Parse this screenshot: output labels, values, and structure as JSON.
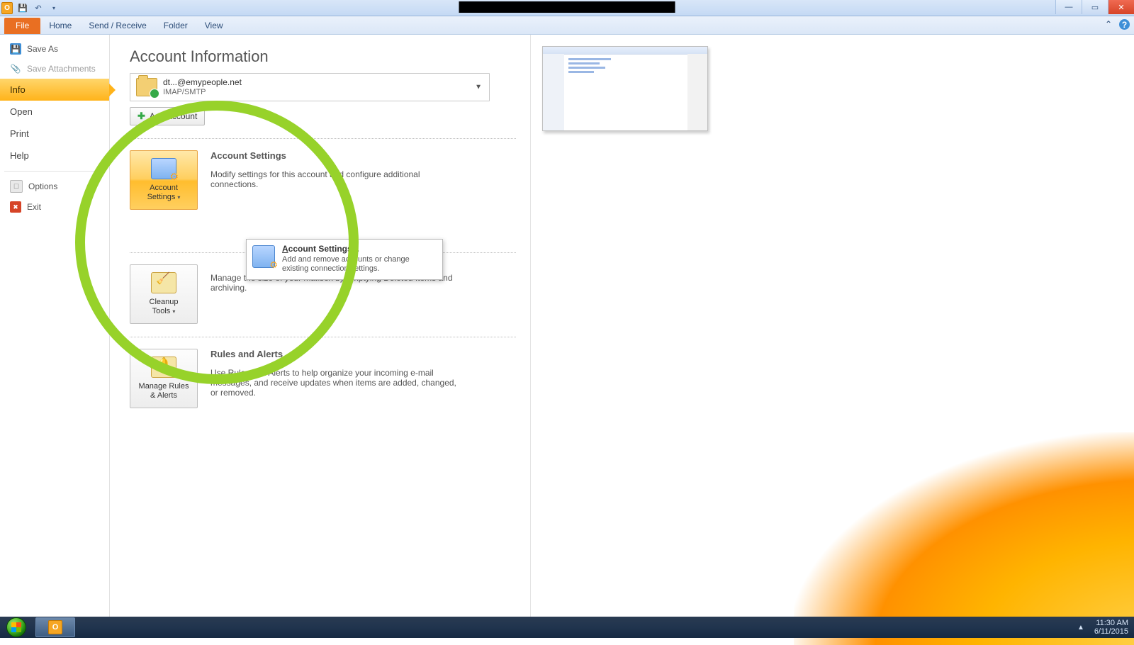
{
  "ribbon": {
    "tabs": [
      "File",
      "Home",
      "Send / Receive",
      "Folder",
      "View"
    ]
  },
  "backstage_nav": {
    "save_as": "Save As",
    "save_attachments": "Save Attachments",
    "info": "Info",
    "open": "Open",
    "print": "Print",
    "help": "Help",
    "options": "Options",
    "exit": "Exit"
  },
  "page": {
    "title": "Account Information",
    "account_email": "dt...@emypeople.net",
    "account_type": "IMAP/SMTP",
    "add_account": "Add Account"
  },
  "sections": {
    "acct_settings": {
      "btn_l1": "Account",
      "btn_l2": "Settings",
      "heading": "Account Settings",
      "body": "Modify settings for this account and configure additional connections."
    },
    "cleanup": {
      "btn_l1": "Cleanup",
      "btn_l2": "Tools",
      "body": "Manage the size of your mailbox by emptying Deleted Items and archiving."
    },
    "rules": {
      "btn_l1": "Manage Rules",
      "btn_l2": "& Alerts",
      "heading": "Rules and Alerts",
      "body": "Use Rules and Alerts to help organize your incoming e-mail messages, and receive updates when items are added, changed, or removed."
    }
  },
  "popup": {
    "title_pre": "A",
    "title_rest": "ccount Settings...",
    "sub": "Add and remove accounts or change existing connection settings."
  },
  "taskbar": {
    "time": "11:30 AM",
    "date": "6/11/2015"
  }
}
